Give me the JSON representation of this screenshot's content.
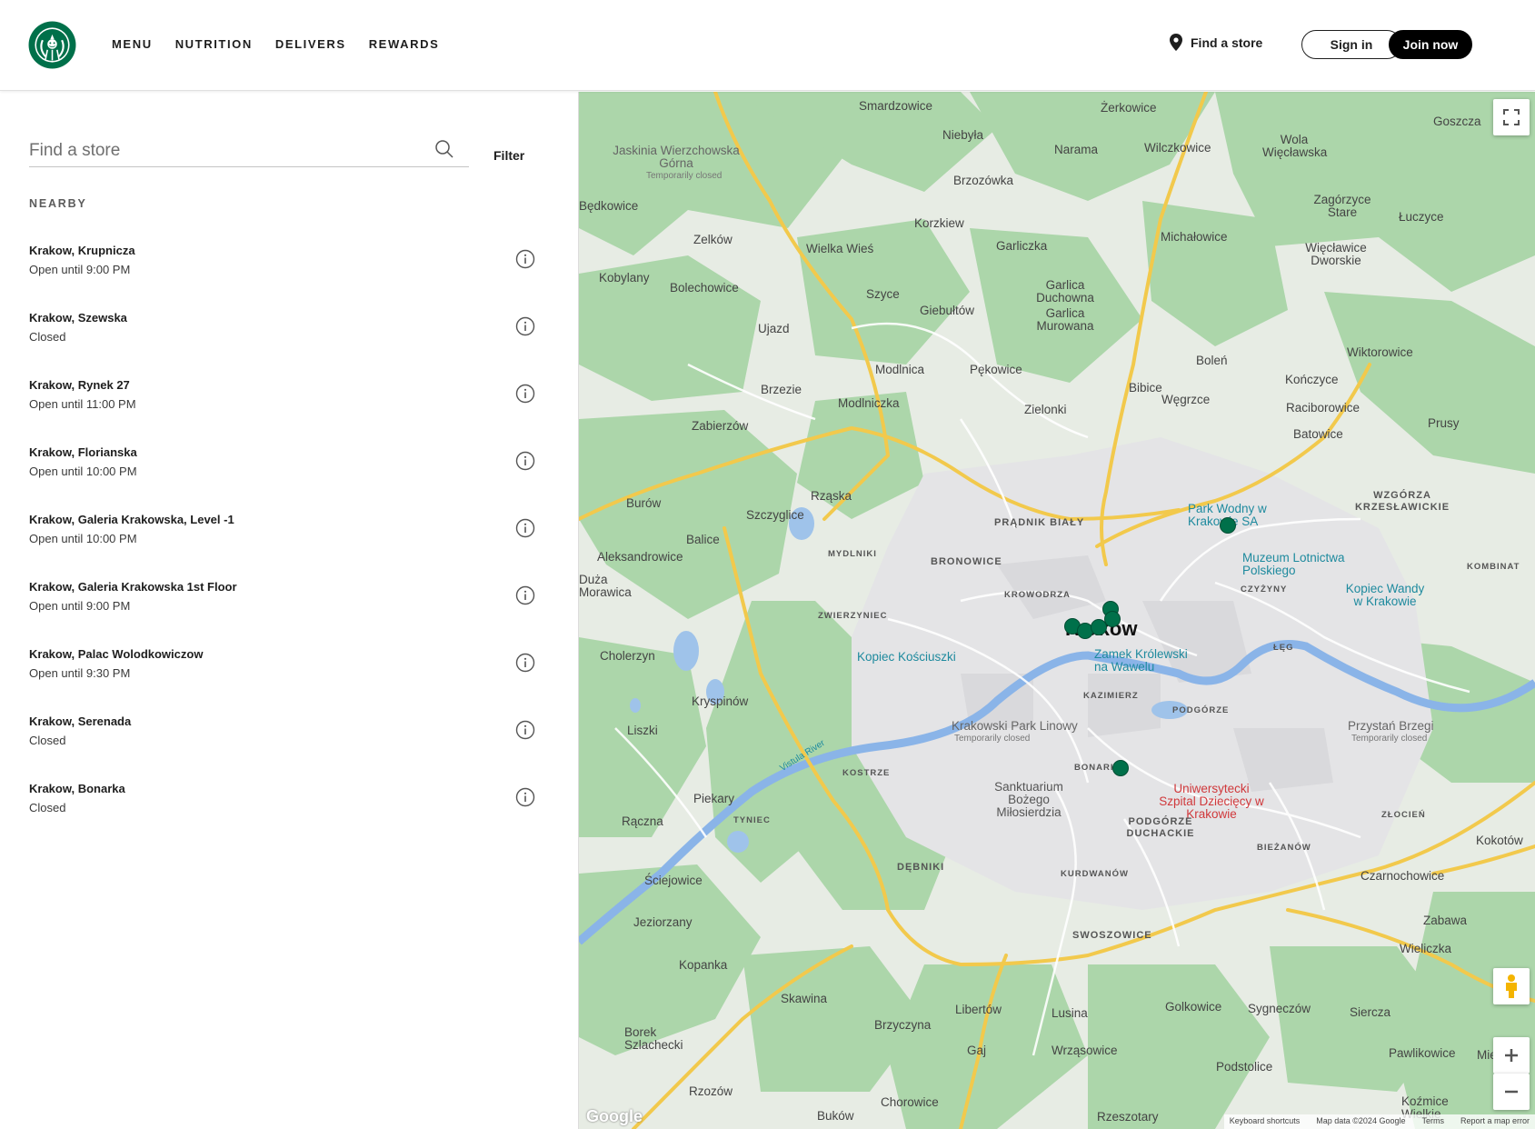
{
  "header": {
    "nav": [
      "MENU",
      "NUTRITION",
      "DELIVERS",
      "REWARDS"
    ],
    "find_store": "Find a store",
    "sign_in": "Sign in",
    "join_now": "Join now"
  },
  "sidebar": {
    "search_placeholder": "Find a store",
    "filter": "Filter",
    "nearby": "NEARBY",
    "stores": [
      {
        "name": "Krakow, Krupnicza",
        "status": "Open until 9:00 PM"
      },
      {
        "name": "Krakow, Szewska",
        "status": "Closed"
      },
      {
        "name": "Krakow, Rynek 27",
        "status": "Open until 11:00 PM"
      },
      {
        "name": "Krakow, Florianska",
        "status": "Open until 10:00 PM"
      },
      {
        "name": "Krakow, Galeria Krakowska, Level -1",
        "status": "Open until 10:00 PM"
      },
      {
        "name": "Krakow, Galeria Krakowska 1st Floor",
        "status": "Open until 9:00 PM"
      },
      {
        "name": "Krakow, Palac Wolodkowiczow",
        "status": "Open until 9:30 PM"
      },
      {
        "name": "Krakow, Serenada",
        "status": "Closed"
      },
      {
        "name": "Krakow, Bonarka",
        "status": "Closed"
      }
    ]
  },
  "map": {
    "city": "Kraków",
    "labels": {
      "smardzowice": "Smardzowice",
      "zerkowice": "Żerkowice",
      "goszcza": "Goszcza",
      "niebyla": "Niebyła",
      "narama": "Narama",
      "wilczkowice": "Wilczkowice",
      "wola_wieclawska": "Wola Więcławska",
      "jaskinia": "Jaskinia Wierzchowska Górna",
      "temporarily_closed": "Temporarily closed",
      "brzozowka": "Brzozówka",
      "bedkowice": "Będkowice",
      "zagorzyce": "Zagórzyce Stare",
      "luczyce": "Łuczyce",
      "korzkiew": "Korzkiew",
      "michalowice": "Michałowice",
      "zelkow": "Zelków",
      "wielka_wies": "Wielka Wieś",
      "garliczka": "Garliczka",
      "wieclawice": "Więcławice Dworskie",
      "kobylany": "Kobylany",
      "bolechowice": "Bolechowice",
      "garlica_duchowna": "Garlica Duchowna",
      "garlica_murowana": "Garlica Murowana",
      "szyce": "Szyce",
      "giebultow": "Giebułtów",
      "ujazd": "Ujazd",
      "wiktorowice": "Wiktorowice",
      "bolen": "Boleń",
      "modlnica": "Modlnica",
      "pekowice": "Pękowice",
      "konczyce": "Kończyce",
      "brzezie": "Brzezie",
      "bibice": "Bibice",
      "wegrzce": "Węgrzce",
      "modlniczka": "Modlniczka",
      "zielonki": "Zielonki",
      "raciborowice": "Raciborowice",
      "zabierzow": "Zabierzów",
      "batowice": "Batowice",
      "prusy": "Prusy",
      "burow": "Burów",
      "rzaska": "Rząska",
      "szczyglice": "Szczyglice",
      "pradnik_bialy": "PRĄDNIK BIAŁY",
      "park_wodny": "Park Wodny w Krakowie SA",
      "wzgorza": "WZGÓRZA KRZESŁAWICKIE",
      "balice": "Balice",
      "aleksandrowice": "Aleksandrowice",
      "mydlniki": "MYDLNIKI",
      "bronowice": "BRONOWICE",
      "muzeum": "Muzeum Lotnictwa Polskiego",
      "kombinat": "KOMBINAT",
      "duza_morawica": "Duża Morawica",
      "krowodrza": "KROWODRZA",
      "czyzyny": "CZYŻYNY",
      "kopiec_wandy": "Kopiec Wandy w Krakowie",
      "zwierzyniec": "ZWIERZYNIEC",
      "cholerzyn": "Cholerzyn",
      "kopiec_kosciuszki": "Kopiec Kościuszki",
      "zamek": "Zamek Królewski na Wawelu",
      "leg": "ŁĘG",
      "vistula_river": "Vistula River",
      "kryspinow": "Kryspinów",
      "kazimierz": "KAZIMIERZ",
      "podgorze": "PODGÓRZE",
      "liszki": "Liszki",
      "park_linowy": "Krakowski Park Linowy",
      "przystan": "Przystań Brzegi",
      "kostrze": "KOSTRZE",
      "bonarka": "BONARKA",
      "piekary": "Piekary",
      "sanktuarium": "Sanktuarium Bożego Miłosierdzia",
      "szpital": "Uniwersytecki Szpital Dziecięcy w Krakowie",
      "zlocien": "ZŁOCIEŃ",
      "raczna": "Rączna",
      "tyniec": "TYNIEC",
      "podgorze_duchackie": "PODGÓRZE DUCHACKIE",
      "biezanow": "BIEŻANÓW",
      "kokotow": "Kokotów",
      "debniki": "DĘBNIKI",
      "kurdwanow": "KURDWANÓW",
      "czarnochowice": "Czarnochowice",
      "sciejowice": "Ściejowice",
      "jeziorzany": "Jeziorzany",
      "swoszowice": "SWOSZOWICE",
      "zabawa": "Zabawa",
      "wieliczka": "Wieliczka",
      "kopanka": "Kopanka",
      "skawina": "Skawina",
      "libertow": "Libertów",
      "lusina": "Lusina",
      "golkowice": "Golkowice",
      "sygneczow": "Sygneczów",
      "siercza": "Siercza",
      "borek": "Borek Szlachecki",
      "brzyczyna": "Brzyczyna",
      "gaj": "Gaj",
      "wrzasowice": "Wrząsowice",
      "pawlikowice": "Pawlikowice",
      "mietniow": "Mietniów",
      "podstolice": "Podstolice",
      "rzozow": "Rzozów",
      "chorowice": "Chorowice",
      "kozmice": "Koźmice Wielkie",
      "bukow": "Buków",
      "rzeszotary": "Rzeszotary"
    },
    "attribution": {
      "keyboard": "Keyboard shortcuts",
      "map_data": "Map data ©2024 Google",
      "terms": "Terms",
      "report": "Report a map error"
    },
    "google": "Google"
  },
  "colors": {
    "brand_green": "#00704a",
    "map_green": "#a8d5a8",
    "road_yellow": "#f5c842"
  }
}
